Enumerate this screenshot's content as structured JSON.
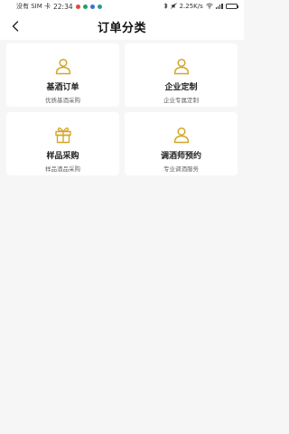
{
  "status_bar": {
    "carrier": "没有 SIM 卡",
    "time": "22:34",
    "speed": "2.25K/s",
    "notification_colors": [
      "#e64545",
      "#19a463",
      "#3b6fd8",
      "#2a9d8f"
    ],
    "battery_level": 0.85
  },
  "header": {
    "title": "订单分类",
    "back_icon": "chevron-left-icon"
  },
  "accent_color": "#d4a62a",
  "cards": [
    {
      "name": "基酒订单",
      "desc": "优质基酒采购",
      "icon": "user-icon"
    },
    {
      "name": "企业定制",
      "desc": "企业专属定制",
      "icon": "user-icon"
    },
    {
      "name": "样品采购",
      "desc": "样品酒品采购",
      "icon": "gift-icon"
    },
    {
      "name": "调酒师预约",
      "desc": "专业调酒服务",
      "icon": "user-icon"
    }
  ]
}
